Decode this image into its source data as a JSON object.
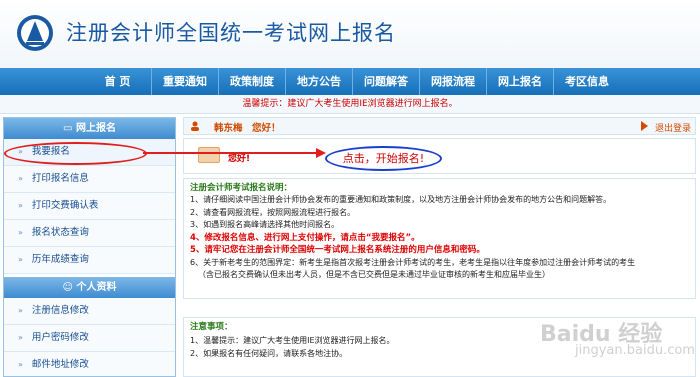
{
  "header": {
    "title": "注册会计师全国统一考试网上报名",
    "logo": "cicpa-logo"
  },
  "nav": {
    "items": [
      "首 页",
      "重要通知",
      "政策制度",
      "地方公告",
      "问题解答",
      "网报流程",
      "网上报名",
      "考区信息"
    ]
  },
  "notice": "温馨提示：建议广大考生使用IE浏览器进行网上报名。",
  "sidebar": {
    "section1": "网上报名",
    "items1": [
      "我要报名",
      "打印报名信息",
      "打印交费确认表",
      "报名状态查询",
      "历年成绩查询"
    ],
    "section2": "个人资料",
    "items2": [
      "注册信息修改",
      "用户密码修改",
      "邮件地址修改"
    ]
  },
  "topbar": {
    "user_name": "韩东梅",
    "greeting": "您好！",
    "logout": "退出登录"
  },
  "panel": {
    "hello": "您好!"
  },
  "callout": "点击，开始报名!",
  "description": {
    "title": "注册会计师考试报名说明：",
    "lines": [
      "1、请仔细阅读中国注册会计师协会发布的重要通知和政策制度，以及地方注册会计师协会发布的地方公告和问题解答。",
      "2、请查看网报流程，按照网报流程进行报名。",
      "3、如遇到报名高峰请选择其他时间报名。",
      "4、修改报名信息、进行网上支付操作，请点击“我要报名”。",
      "5、请牢记您在注册会计师全国统一考试网上报名系统注册的用户信息和密码。",
      "6、关于新老考生的范围界定：新考生是指首次报考注册会计师考试的考生，老考生是指以往年度参加过注册会计师考试的考生",
      "（含已报名交费确认但未出考人员，但是不含已交费但是未通过毕业证审核的新考生和应届毕业生）"
    ]
  },
  "note": {
    "title": "注意事项：",
    "lines": [
      "1、温馨提示：建议广大考生使用IE浏览器进行网上报名。",
      "2、如果报名有任何疑问，请联系各地注协。"
    ]
  },
  "watermark": {
    "text": "Baidu 经验",
    "sub": "jingyan.baidu.com"
  },
  "colors": {
    "nav": "#1f7cc6",
    "accent_red": "#dd0000",
    "title_blue": "#1a5aa3"
  }
}
